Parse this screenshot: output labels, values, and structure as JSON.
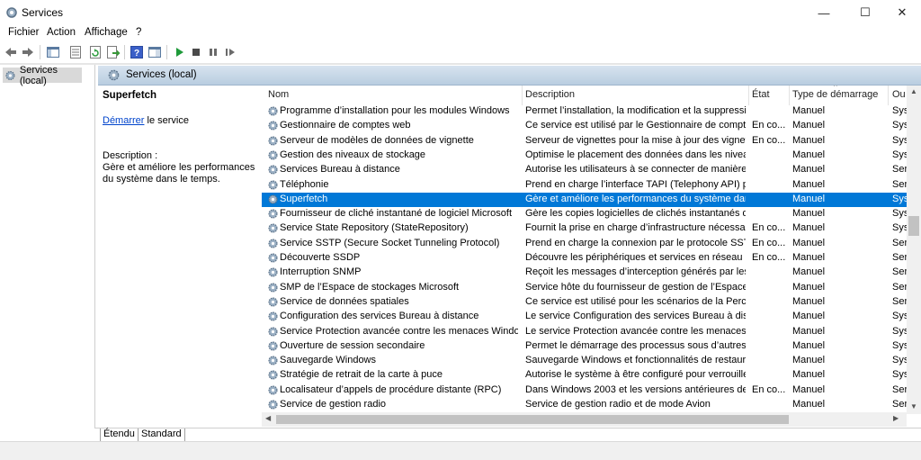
{
  "window": {
    "title": "Services",
    "minimize": "—",
    "maximize": "☐",
    "close": "✕"
  },
  "menu": {
    "items": [
      "Fichier",
      "Action",
      "Affichage",
      "?"
    ]
  },
  "tree": {
    "item": "Services (local)"
  },
  "pane": {
    "header": "Services (local)"
  },
  "details": {
    "title": "Superfetch",
    "action_link": "Démarrer",
    "action_rest": " le service",
    "desc_label": "Description :",
    "desc_text": "Gère et améliore les performances du système dans le temps."
  },
  "table": {
    "columns": {
      "name": "Nom",
      "description": "Description",
      "state": "État",
      "startup": "Type de démarrage",
      "other": "Ou"
    },
    "rows": [
      {
        "name": "Programme d’installation pour les modules Windows",
        "description": "Permet l’installation, la modification et la suppressio...",
        "state": "",
        "startup": "Manuel",
        "other": "Sys"
      },
      {
        "name": "Gestionnaire de comptes web",
        "description": "Ce service est utilisé par le Gestionnaire de comptes ...",
        "state": "En co...",
        "startup": "Manuel",
        "other": "Sys"
      },
      {
        "name": "Serveur de modèles de données de vignette",
        "description": "Serveur de vignettes pour la mise à jour des vignettes...",
        "state": "En co...",
        "startup": "Manuel",
        "other": "Sys"
      },
      {
        "name": "Gestion des niveaux de stockage",
        "description": "Optimise le placement des données dans les niveaux...",
        "state": "",
        "startup": "Manuel",
        "other": "Sys"
      },
      {
        "name": "Services Bureau à distance",
        "description": "Autorise les utilisateurs à se connecter de manière in...",
        "state": "",
        "startup": "Manuel",
        "other": "Ser"
      },
      {
        "name": "Téléphonie",
        "description": "Prend en charge l’interface TAPI (Telephony API) pour...",
        "state": "",
        "startup": "Manuel",
        "other": "Ser"
      },
      {
        "name": "Superfetch",
        "description": "Gère et améliore les performances du système dans l...",
        "state": "",
        "startup": "Manuel",
        "other": "Sys"
      },
      {
        "name": "Fournisseur de cliché instantané de logiciel Microsoft",
        "description": "Gère les copies logicielles de clichés instantanés de v...",
        "state": "",
        "startup": "Manuel",
        "other": "Sys"
      },
      {
        "name": "Service State Repository (StateRepository)",
        "description": "Fournit la prise en charge d’infrastructure nécessaire...",
        "state": "En co...",
        "startup": "Manuel",
        "other": "Sys"
      },
      {
        "name": "Service SSTP (Secure Socket Tunneling Protocol)",
        "description": "Prend en charge la connexion par le protocole SSTP (...",
        "state": "En co...",
        "startup": "Manuel",
        "other": "Ser"
      },
      {
        "name": "Découverte SSDP",
        "description": "Découvre les périphériques et services en réseau qui ...",
        "state": "En co...",
        "startup": "Manuel",
        "other": "Ser"
      },
      {
        "name": "Interruption SNMP",
        "description": "Reçoit les messages d’interception générés par les a...",
        "state": "",
        "startup": "Manuel",
        "other": "Ser"
      },
      {
        "name": "SMP de l’Espace de stockages Microsoft",
        "description": "Service hôte du fournisseur de gestion de l’Espace d...",
        "state": "",
        "startup": "Manuel",
        "other": "Ser"
      },
      {
        "name": "Service de données spatiales",
        "description": "Ce service est utilisé pour les scénarios de la Percepti...",
        "state": "",
        "startup": "Manuel",
        "other": "Ser"
      },
      {
        "name": "Configuration des services Bureau à distance",
        "description": "Le service Configuration des services Bureau à distan...",
        "state": "",
        "startup": "Manuel",
        "other": "Sys"
      },
      {
        "name": "Service Protection avancée contre les menaces Windows D...",
        "description": "Le service Protection avancée contre les menaces Wi...",
        "state": "",
        "startup": "Manuel",
        "other": "Sys"
      },
      {
        "name": "Ouverture de session secondaire",
        "description": "Permet le démarrage des processus sous d’autres inf...",
        "state": "",
        "startup": "Manuel",
        "other": "Sys"
      },
      {
        "name": "Sauvegarde Windows",
        "description": "Sauvegarde Windows et fonctionnalités de restaurat...",
        "state": "",
        "startup": "Manuel",
        "other": "Sys"
      },
      {
        "name": "Stratégie de retrait de la carte à puce",
        "description": "Autorise le système à être configuré pour verrouiller ...",
        "state": "",
        "startup": "Manuel",
        "other": "Sys"
      },
      {
        "name": "Localisateur d’appels de procédure distante (RPC)",
        "description": "Dans Windows 2003 et les versions antérieures de W...",
        "state": "En co...",
        "startup": "Manuel",
        "other": "Ser"
      },
      {
        "name": "Service de gestion radio",
        "description": "Service de gestion radio et de mode Avion",
        "state": "",
        "startup": "Manuel",
        "other": "Ser"
      }
    ],
    "selected_row": 6
  },
  "tabs": [
    "Étendu",
    "Standard"
  ],
  "colors": {
    "selection": "#0078d7",
    "link": "#0044cc"
  },
  "icons": [
    "back-arrow-icon",
    "forward-arrow-icon",
    "console-tree-icon",
    "properties-icon",
    "refresh-icon",
    "export-list-icon",
    "help-icon",
    "show-hide-icon",
    "play-icon",
    "stop-icon",
    "pause-icon",
    "restart-icon",
    "gear-icon"
  ]
}
